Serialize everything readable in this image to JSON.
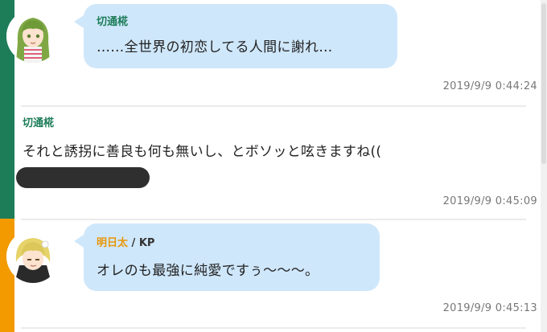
{
  "colors": {
    "green_strip": "#1d7d59",
    "orange_strip": "#f29a00",
    "bubble": "#cfe7fb",
    "green_name": "#1d7d59",
    "orange_name": "#e8960a"
  },
  "messages": [
    {
      "speaker": "切通椛",
      "text": "……全世界の初恋してる人間に謝れ…",
      "timestamp": "2019/9/9 0:44:24",
      "avatar": "green-haired-character-avatar"
    },
    {
      "speaker": "切通椛",
      "text": "それと誘拐に善良も何も無いし、とボソッと呟きますね((",
      "timestamp": "2019/9/9 0:45:09"
    },
    {
      "speaker": "明日太",
      "role": "/ KP",
      "text": "オレのも最強に純愛ですぅ～～～。",
      "timestamp": "2019/9/9 0:45:13",
      "avatar": "blonde-character-avatar"
    }
  ]
}
